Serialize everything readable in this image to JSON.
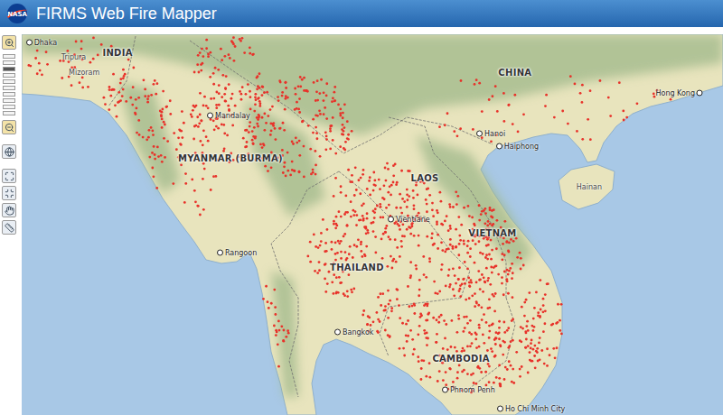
{
  "window": {
    "title": "FIRMS Web Fire Mapper",
    "logo": "NASA"
  },
  "toolbar": {
    "zoom_level": 0.8
  },
  "map": {
    "labels": [
      {
        "text": "INDIA",
        "kind": "country",
        "lon": 92.21,
        "lat": 23.65
      },
      {
        "text": "CHINA",
        "kind": "country",
        "lon": 107.22,
        "lat": 22.94
      },
      {
        "text": "MYANMAR (BURMA)",
        "kind": "country",
        "lon": 96.47,
        "lat": 19.88
      },
      {
        "text": "LAOS",
        "kind": "country",
        "lon": 103.81,
        "lat": 19.17
      },
      {
        "text": "VIETNAM",
        "kind": "country",
        "lon": 106.37,
        "lat": 17.2
      },
      {
        "text": "THAILAND",
        "kind": "country",
        "lon": 101.25,
        "lat": 15.98
      },
      {
        "text": "CAMBODIA",
        "kind": "country",
        "lon": 105.18,
        "lat": 12.72
      },
      {
        "text": "Hainan",
        "kind": "region",
        "lon": 110.02,
        "lat": 18.85
      },
      {
        "text": "Tripura",
        "kind": "region",
        "lon": 90.55,
        "lat": 23.5
      },
      {
        "text": "Mizoram",
        "kind": "region",
        "lon": 90.95,
        "lat": 22.95
      },
      {
        "text": "Dhaka",
        "kind": "city",
        "lon": 88.85,
        "lat": 24.0
      },
      {
        "text": "Mandalay",
        "kind": "city",
        "lon": 95.69,
        "lat": 21.4
      },
      {
        "text": "Rangoon",
        "kind": "city",
        "lon": 96.06,
        "lat": 16.49
      },
      {
        "text": "Bangkok",
        "kind": "city",
        "lon": 100.5,
        "lat": 13.65
      },
      {
        "text": "Vientiane",
        "kind": "city",
        "lon": 102.51,
        "lat": 17.69
      },
      {
        "text": "Hanoi",
        "kind": "city",
        "lon": 105.86,
        "lat": 20.75
      },
      {
        "text": "Haiphong",
        "kind": "city",
        "lon": 106.6,
        "lat": 20.3
      },
      {
        "text": "Hong Kong",
        "kind": "city",
        "lon": 114.22,
        "lat": 22.2
      },
      {
        "text": "Phnom Penh",
        "kind": "city",
        "lon": 104.56,
        "lat": 11.59
      },
      {
        "text": "Ho Chi Minh City",
        "kind": "city",
        "lon": 106.64,
        "lat": 10.91
      }
    ]
  }
}
